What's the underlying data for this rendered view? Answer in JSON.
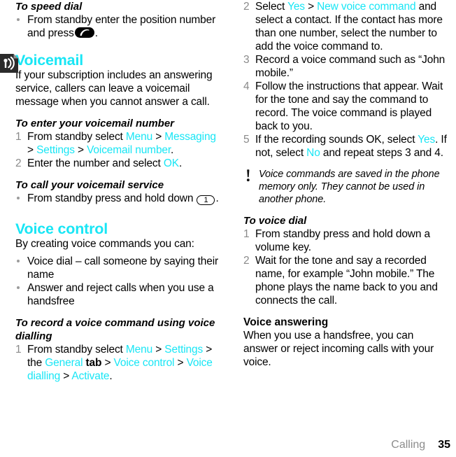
{
  "document": {
    "footer": {
      "chapter": "Calling",
      "page_number": "35"
    }
  },
  "left_column": {
    "speed_dial": {
      "heading": "To speed dial",
      "bullet_before_key": "From standby enter the position number and press",
      "key_icon": "call-key-icon",
      "bullet_after_key": "."
    },
    "voicemail": {
      "icon": "voicemail-document-icon",
      "title": "Voicemail",
      "intro": "If your subscription includes an answering service, callers can leave a voicemail message when you cannot answer a call.",
      "enter_number": {
        "heading": "To enter your voicemail number",
        "steps": [
          {
            "number": "1",
            "parts": [
              {
                "text": "From standby select ",
                "style": "plain"
              },
              {
                "text": "Menu",
                "style": "link"
              },
              {
                "text": " > ",
                "style": "plain"
              },
              {
                "text": "Messaging",
                "style": "link"
              },
              {
                "text": " > ",
                "style": "plain"
              },
              {
                "text": "Settings",
                "style": "link"
              },
              {
                "text": " > ",
                "style": "plain"
              },
              {
                "text": "Voicemail number",
                "style": "link"
              },
              {
                "text": ".",
                "style": "plain"
              }
            ]
          },
          {
            "number": "2",
            "parts": [
              {
                "text": "Enter the number and select ",
                "style": "plain"
              },
              {
                "text": "OK",
                "style": "link"
              },
              {
                "text": ".",
                "style": "plain"
              }
            ]
          }
        ]
      },
      "call_service": {
        "heading": "To call your voicemail service",
        "bullet_before_key": "From standby press and hold down",
        "key_label": "1",
        "bullet_after_key": "."
      }
    },
    "voice_control": {
      "title": "Voice control",
      "intro": "By creating voice commands you can:",
      "bullets": [
        "Voice dial – call someone by saying their name",
        "Answer and reject calls when you use a handsfree"
      ],
      "record_command": {
        "heading": "To record a voice command using voice dialling",
        "steps": [
          {
            "number": "1",
            "parts": [
              {
                "text": "From standby select ",
                "style": "plain"
              },
              {
                "text": "Menu",
                "style": "link"
              },
              {
                "text": " > ",
                "style": "plain"
              },
              {
                "text": "Settings",
                "style": "link"
              },
              {
                "text": " > the ",
                "style": "plain"
              },
              {
                "text": "General",
                "style": "link"
              },
              {
                "text": " tab",
                "style": "bold"
              },
              {
                "text": " > ",
                "style": "plain"
              },
              {
                "text": "Voice control",
                "style": "link"
              },
              {
                "text": " > ",
                "style": "plain"
              },
              {
                "text": "Voice dialling",
                "style": "link"
              },
              {
                "text": " > ",
                "style": "plain"
              },
              {
                "text": "Activate",
                "style": "link"
              },
              {
                "text": ".",
                "style": "plain"
              }
            ]
          }
        ]
      }
    }
  },
  "right_column": {
    "record_command_steps": [
      {
        "number": "2",
        "parts": [
          {
            "text": "Select ",
            "style": "plain"
          },
          {
            "text": "Yes",
            "style": "link"
          },
          {
            "text": " > ",
            "style": "plain"
          },
          {
            "text": "New voice command",
            "style": "link"
          },
          {
            "text": " and select a contact. If the contact has more than one number, select the number to add the voice command to.",
            "style": "plain"
          }
        ]
      },
      {
        "number": "3",
        "parts": [
          {
            "text": "Record a voice command such as “John mobile.”",
            "style": "plain"
          }
        ]
      },
      {
        "number": "4",
        "parts": [
          {
            "text": "Follow the instructions that appear. Wait for the tone and say the command to record. The voice command is played back to you.",
            "style": "plain"
          }
        ]
      },
      {
        "number": "5",
        "parts": [
          {
            "text": "If the recording sounds OK, select ",
            "style": "plain"
          },
          {
            "text": "Yes",
            "style": "link"
          },
          {
            "text": ". If not, select ",
            "style": "plain"
          },
          {
            "text": "No",
            "style": "link"
          },
          {
            "text": " and repeat steps 3 and 4.",
            "style": "plain"
          }
        ]
      }
    ],
    "note": {
      "icon": "exclamation-icon",
      "text": "Voice commands are saved in the phone memory only. They cannot be used in another phone."
    },
    "voice_dial": {
      "heading": "To voice dial",
      "steps": [
        {
          "number": "1",
          "parts": [
            {
              "text": "From standby press and hold down a volume key.",
              "style": "plain"
            }
          ]
        },
        {
          "number": "2",
          "parts": [
            {
              "text": "Wait for the tone and say a recorded name, for example “John mobile.” The phone plays the name back to you and connects the call.",
              "style": "plain"
            }
          ]
        }
      ]
    },
    "voice_answering": {
      "title": "Voice answering",
      "text": "When you use a handsfree, you can answer or reject incoming calls with your voice."
    }
  },
  "colors": {
    "link": "#19e6f5",
    "step_number": "#8a8a8a",
    "footer_chapter": "#8c8c8c",
    "text": "#000000"
  }
}
